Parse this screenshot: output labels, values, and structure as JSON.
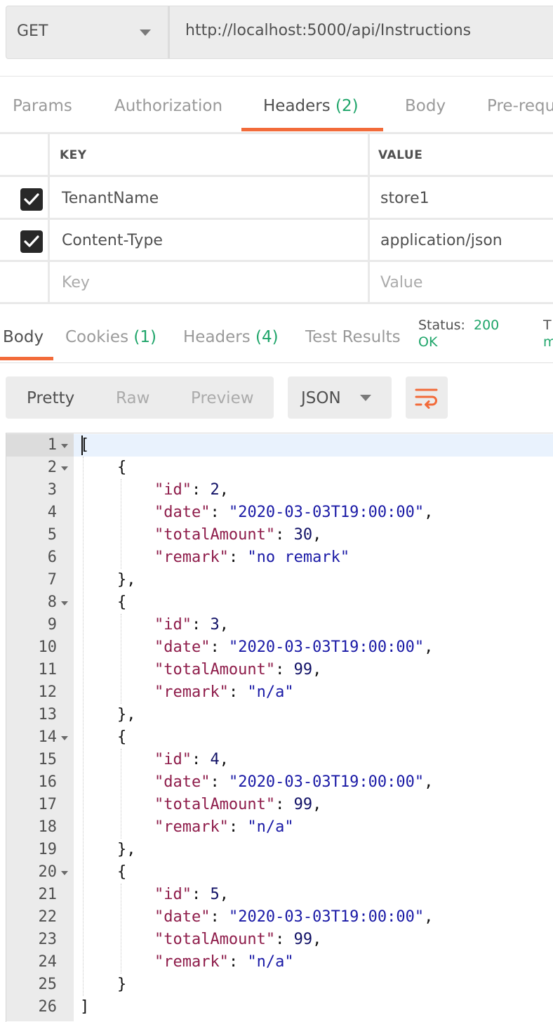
{
  "request": {
    "method": "GET",
    "url": "http://localhost:5000/api/Instructions"
  },
  "request_tabs": [
    {
      "label": "Params",
      "count": ""
    },
    {
      "label": "Authorization",
      "count": ""
    },
    {
      "label": "Headers",
      "count": "(2)"
    },
    {
      "label": "Body",
      "count": ""
    },
    {
      "label": "Pre-requ",
      "count": ""
    }
  ],
  "headers_table": {
    "columns": {
      "key": "KEY",
      "value": "VALUE"
    },
    "rows": [
      {
        "enabled": true,
        "key": "TenantName",
        "value": "store1"
      },
      {
        "enabled": true,
        "key": "Content-Type",
        "value": "application/json"
      }
    ],
    "placeholder": {
      "key": "Key",
      "value": "Value"
    }
  },
  "response_tabs": [
    {
      "label": "Body",
      "count": ""
    },
    {
      "label": "Cookies",
      "count": "(1)"
    },
    {
      "label": "Headers",
      "count": "(4)"
    },
    {
      "label": "Test Results",
      "count": ""
    }
  ],
  "status": {
    "label": "Status:",
    "code": "200",
    "text": "OK",
    "time_label": "T",
    "time_value": "m"
  },
  "view": {
    "options": [
      "Pretty",
      "Raw",
      "Preview"
    ],
    "selected": "Pretty",
    "format": "JSON",
    "wrap_icon": "wrap-lines-icon"
  },
  "colors": {
    "accent": "#f26b3a",
    "success": "#1fa56a"
  },
  "response_body": {
    "lines": [
      "1",
      "2",
      "3",
      "4",
      "5",
      "6",
      "7",
      "8",
      "9",
      "10",
      "11",
      "12",
      "13",
      "14",
      "15",
      "16",
      "17",
      "18",
      "19",
      "20",
      "21",
      "22",
      "23",
      "24",
      "25",
      "26"
    ],
    "records": [
      {
        "id": 2,
        "date": "2020-03-03T19:00:00",
        "totalAmount": 30,
        "remark": "no remark"
      },
      {
        "id": 3,
        "date": "2020-03-03T19:00:00",
        "totalAmount": 99,
        "remark": "n/a"
      },
      {
        "id": 4,
        "date": "2020-03-03T19:00:00",
        "totalAmount": 99,
        "remark": "n/a"
      },
      {
        "id": 5,
        "date": "2020-03-03T19:00:00",
        "totalAmount": 99,
        "remark": "n/a"
      }
    ]
  }
}
